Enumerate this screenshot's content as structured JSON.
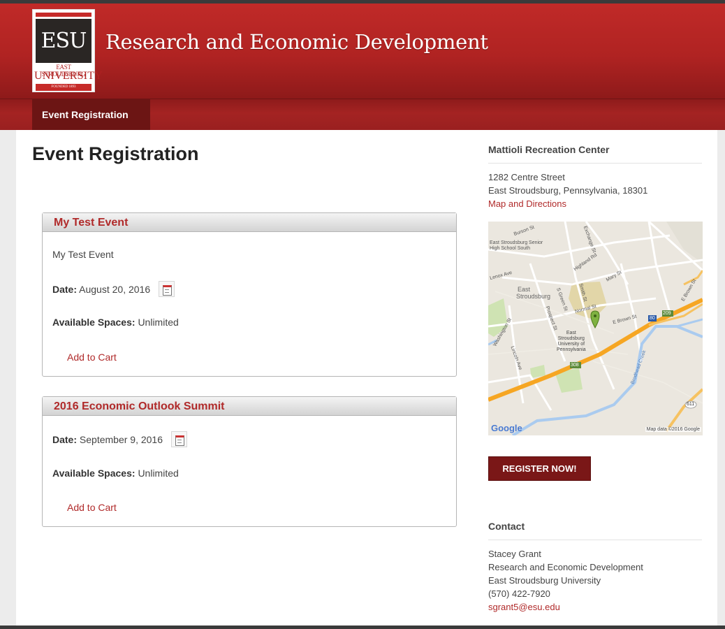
{
  "header": {
    "logo": {
      "mark": "ESU",
      "line1": "EAST STROUDSBURG",
      "line2": "UNIVERSITY",
      "founded": "FOUNDED 1893"
    },
    "site_title": "Research and Economic Development"
  },
  "nav": {
    "items": [
      {
        "label": "Event Registration"
      }
    ]
  },
  "main": {
    "page_title": "Event Registration",
    "events": [
      {
        "title": "My Test Event",
        "description": "My Test Event",
        "date_label": "Date:",
        "date": "August 20, 2016",
        "spaces_label": "Available Spaces:",
        "spaces": "Unlimited",
        "add_to_cart": "Add to Cart"
      },
      {
        "title": "2016 Economic Outlook Summit",
        "date_label": "Date:",
        "date": "September 9, 2016",
        "spaces_label": "Available Spaces:",
        "spaces": "Unlimited",
        "add_to_cart": "Add to Cart"
      }
    ]
  },
  "sidebar": {
    "location": {
      "heading": "Mattioli Recreation Center",
      "address1": "1282 Centre Street",
      "address2": "East Stroudsburg, Pennsylvania, 18301",
      "directions_link": "Map and Directions"
    },
    "map": {
      "labels": {
        "school": "East Stroudsburg Senior",
        "school2": "High School South",
        "burson": "Burson St",
        "exchange": "Exchange St",
        "highland": "Highland Rd",
        "lenox": "Lenox Ave",
        "east": "East",
        "stroudsburg": "Stroudsburg",
        "mary": "Mary St",
        "smith": "Smith St",
        "green": "S Green St",
        "normal": "Normal St",
        "ebrown": "E Brown St",
        "ebrown2": "E Brown St",
        "prospect": "Prospect St",
        "washington": "Washington St",
        "univ1": "East",
        "univ2": "Stroudsburg",
        "univ3": "University of",
        "univ4": "Pennsylvania",
        "lincoln": "Lincoln Ave",
        "brodhead": "Brodhead Creek",
        "r209": "209",
        "r80": "80",
        "r308": "308",
        "r611": "611",
        "google": "Google",
        "map_data": "Map data ©2016 Google"
      }
    },
    "register_button": "REGISTER NOW!",
    "contact": {
      "heading": "Contact",
      "name": "Stacey Grant",
      "department": "Research and Economic Development",
      "university": "East Stroudsburg University",
      "phone": "(570) 422-7920",
      "email": "sgrant5@esu.edu"
    }
  },
  "colors": {
    "header_red": "#b02322",
    "nav_dark": "#6c1514",
    "link_red": "#b02a2a",
    "button": "#7a1717"
  }
}
